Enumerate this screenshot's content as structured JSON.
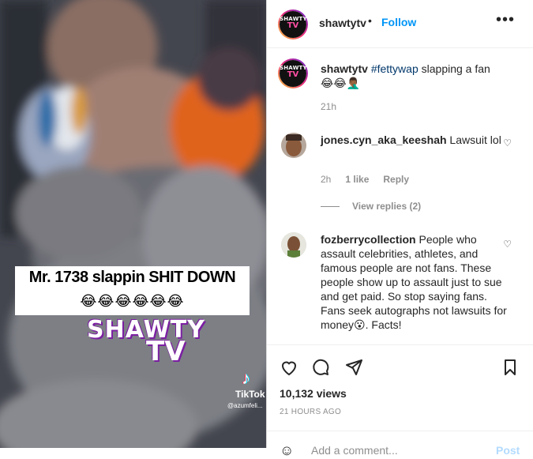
{
  "video": {
    "caption_line1": "Mr. 1738 slappin SHIT DOWN",
    "caption_line2": "😂😂😂😂😂😂",
    "watermark_brand": "SHAWTY",
    "watermark_tv": "TV",
    "tiktok_label": "TikTok",
    "tiktok_user": "@azumfeli..."
  },
  "header": {
    "username": "shawtytv",
    "separator": "•",
    "follow_label": "Follow",
    "more_label": "•••"
  },
  "avatar": {
    "brand_top": "SHAWTY",
    "brand_bottom": "TV"
  },
  "post_caption": {
    "username": "shawtytv",
    "hashtag": "#fettywap",
    "text": " slapping a fan",
    "emojis": "😂😂🤦🏾‍♂️",
    "time": "21h"
  },
  "comments": [
    {
      "username": "jones.cyn_aka_keeshah",
      "text": " Lawsuit lol",
      "time": "2h",
      "likes": "1 like",
      "reply": "Reply"
    },
    {
      "username": "fozberrycollection",
      "text": " People who assault celebrities, athletes, and famous people are not fans. These people show up to assault just to sue and get paid. So stop saying fans. Fans seek autographs not lawsuits for money😮. Facts!"
    }
  ],
  "view_replies": "View replies (2)",
  "stats": {
    "views": "10,132 views",
    "time_ago": "21 HOURS AGO"
  },
  "add_comment": {
    "placeholder": "Add a comment...",
    "post_label": "Post"
  },
  "colors": {
    "accent": "#0095f6",
    "text": "#262626",
    "muted": "#8e8e8e"
  }
}
